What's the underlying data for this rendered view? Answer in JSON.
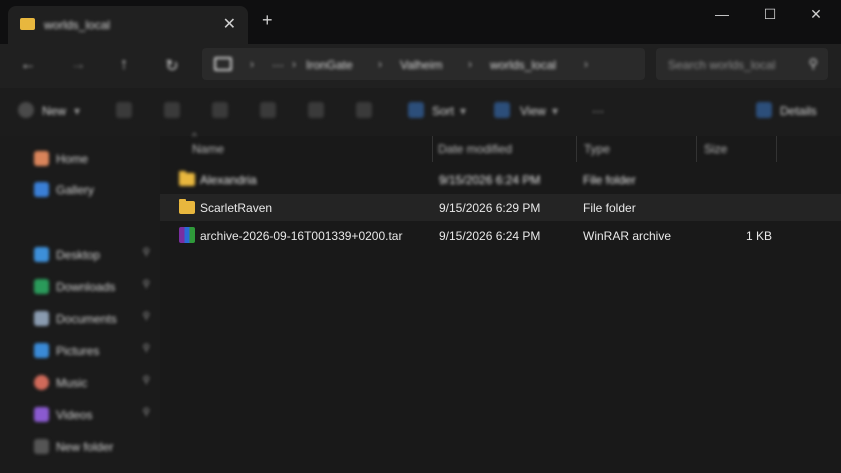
{
  "window": {
    "tab_title": "worlds_local",
    "close_tab": "✕",
    "new_tab": "+",
    "minimize": "—",
    "maximize": "☐",
    "close": "✕"
  },
  "nav": {
    "back": "←",
    "forward": "→",
    "up": "↑",
    "refresh": "↻",
    "breadcrumbs": [
      "IronGate",
      "Valheim",
      "worlds_local"
    ],
    "ellipsis": "···",
    "search_placeholder": "Search worlds_local"
  },
  "toolbar": {
    "new_label": "New",
    "sort_label": "Sort",
    "view_label": "View",
    "more_label": "···",
    "details_label": "Details"
  },
  "sidebar": {
    "items": [
      {
        "label": "Home",
        "icon": "home-icon",
        "pinned": false
      },
      {
        "label": "Gallery",
        "icon": "gallery-icon",
        "pinned": false
      },
      {
        "label": "Desktop",
        "icon": "desktop-icon",
        "pinned": true
      },
      {
        "label": "Downloads",
        "icon": "downloads-icon",
        "pinned": true
      },
      {
        "label": "Documents",
        "icon": "documents-icon",
        "pinned": true
      },
      {
        "label": "Pictures",
        "icon": "pictures-icon",
        "pinned": true
      },
      {
        "label": "Music",
        "icon": "music-icon",
        "pinned": true
      },
      {
        "label": "Videos",
        "icon": "videos-icon",
        "pinned": true
      },
      {
        "label": "New folder",
        "icon": "folder-icon",
        "pinned": false
      }
    ]
  },
  "columns": {
    "name": "Name",
    "date": "Date modified",
    "type": "Type",
    "size": "Size"
  },
  "files": [
    {
      "name": "Alexandria",
      "date": "9/15/2026 6:24 PM",
      "type": "File folder",
      "size": "",
      "icon": "folder-icon"
    },
    {
      "name": "ScarletRaven",
      "date": "9/15/2026 6:29 PM",
      "type": "File folder",
      "size": "",
      "icon": "folder-icon"
    },
    {
      "name": "archive-2026-09-16T001339+0200.tar",
      "date": "9/15/2026 6:24 PM",
      "type": "WinRAR archive",
      "size": "1 KB",
      "icon": "winrar-archive-icon"
    }
  ],
  "colors": {
    "folder": "#e8b73e",
    "background": "#191919",
    "selected_row": "#242424"
  }
}
